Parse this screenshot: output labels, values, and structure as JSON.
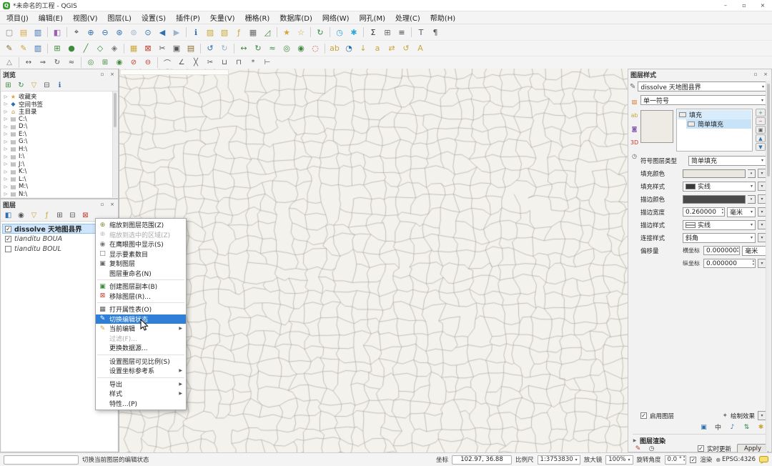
{
  "window": {
    "title": "*未命名的工程 - QGIS",
    "controls": {
      "minimize": "–",
      "maximize": "▫",
      "close": "×"
    }
  },
  "menu": {
    "items": [
      {
        "n": "menu-project",
        "label": "项目(J)"
      },
      {
        "n": "menu-edit",
        "label": "编辑(E)"
      },
      {
        "n": "menu-view",
        "label": "视图(V)"
      },
      {
        "n": "menu-layer",
        "label": "图层(L)"
      },
      {
        "n": "menu-settings",
        "label": "设置(S)"
      },
      {
        "n": "menu-plugins",
        "label": "插件(P)"
      },
      {
        "n": "menu-vector",
        "label": "矢量(V)"
      },
      {
        "n": "menu-raster",
        "label": "栅格(R)"
      },
      {
        "n": "menu-database",
        "label": "数据库(D)"
      },
      {
        "n": "menu-web",
        "label": "网络(W)"
      },
      {
        "n": "menu-mesh",
        "label": "网孔(M)"
      },
      {
        "n": "menu-processing",
        "label": "处理(C)"
      },
      {
        "n": "menu-help",
        "label": "帮助(H)"
      }
    ]
  },
  "toolbars": {
    "row1": [
      {
        "n": "new-project-icon",
        "g": "▢",
        "c": "#8a8a8a"
      },
      {
        "n": "open-project-icon",
        "g": "▤",
        "c": "#d9a33c"
      },
      {
        "n": "save-project-icon",
        "g": "▥",
        "c": "#3a6db4"
      },
      {
        "sep": 1
      },
      {
        "n": "style-manager-icon",
        "g": "◧",
        "c": "#9a5fb0"
      },
      {
        "sep": 1
      },
      {
        "n": "pan-map-icon",
        "g": "⌖",
        "c": "#333333"
      },
      {
        "n": "zoom-in-icon",
        "g": "⊕",
        "c": "#2e6fb0"
      },
      {
        "n": "zoom-out-icon",
        "g": "⊖",
        "c": "#2e6fb0"
      },
      {
        "n": "zoom-full-icon",
        "g": "⊛",
        "c": "#2e6fb0"
      },
      {
        "n": "zoom-to-selection-icon",
        "g": "⊚",
        "c": "#9ab4cc"
      },
      {
        "n": "zoom-to-layer-icon",
        "g": "⊙",
        "c": "#2e6fb0"
      },
      {
        "n": "zoom-last-icon",
        "g": "◀",
        "c": "#2e6fb0"
      },
      {
        "n": "zoom-next-icon",
        "g": "▶",
        "c": "#9ab4cc"
      },
      {
        "sep": 1
      },
      {
        "n": "identify-icon",
        "g": "ℹ",
        "c": "#2e6fb0"
      },
      {
        "n": "select-features-icon",
        "g": "▨",
        "c": "#c9a83a"
      },
      {
        "n": "deselect-icon",
        "g": "▧",
        "c": "#c9a83a"
      },
      {
        "n": "select-expression-icon",
        "g": "ƒ",
        "c": "#c9a83a"
      },
      {
        "n": "attribute-table-icon",
        "g": "▦",
        "c": "#666666"
      },
      {
        "n": "measure-icon",
        "g": "◿",
        "c": "#4a8a3c"
      },
      {
        "sep": 1
      },
      {
        "n": "new-bookmark-icon",
        "g": "★",
        "c": "#d9a33c"
      },
      {
        "n": "show-bookmarks-icon",
        "g": "☆",
        "c": "#d9a33c"
      },
      {
        "sep": 1
      },
      {
        "n": "refresh-map-icon",
        "g": "↻",
        "c": "#2e8a4a"
      },
      {
        "sep": 1
      },
      {
        "n": "temporal-control-icon",
        "g": "◷",
        "c": "#2ea8d8"
      },
      {
        "n": "freeze-canvas-icon",
        "g": "✱",
        "c": "#2ea8d8"
      },
      {
        "sep": 1
      },
      {
        "n": "statistics-icon",
        "g": "Σ",
        "c": "#333333"
      },
      {
        "n": "processing-toolbox-icon",
        "g": "⊞",
        "c": "#666666"
      },
      {
        "n": "toolbox-menu-icon",
        "g": "≡",
        "c": "#333333"
      },
      {
        "sep": 1
      },
      {
        "n": "annotation-text-icon",
        "g": "T",
        "c": "#555555"
      },
      {
        "n": "annotation-form-icon",
        "g": "¶",
        "c": "#555555"
      }
    ],
    "row2": [
      {
        "n": "current-edits-icon",
        "g": "✎",
        "c": "#8a6d2a"
      },
      {
        "n": "toggle-editing-icon",
        "g": "✎",
        "c": "#caa53a"
      },
      {
        "n": "save-edits-icon",
        "g": "▥",
        "c": "#3a6db4"
      },
      {
        "sep": 1
      },
      {
        "n": "add-record-icon",
        "g": "⊞",
        "c": "#3f8a3f"
      },
      {
        "n": "add-point-icon",
        "g": "●",
        "c": "#3f8a3f"
      },
      {
        "n": "add-line-icon",
        "g": "╱",
        "c": "#3f8a3f"
      },
      {
        "n": "add-polygon-icon",
        "g": "◇",
        "c": "#3f8a3f"
      },
      {
        "n": "vertex-tool-icon",
        "g": "◈",
        "c": "#777777"
      },
      {
        "sep": 1
      },
      {
        "n": "modify-attributes-icon",
        "g": "▦",
        "c": "#c9a83a"
      },
      {
        "n": "delete-selected-icon",
        "g": "⊠",
        "c": "#c0392b"
      },
      {
        "n": "cut-features-icon",
        "g": "✂",
        "c": "#555555"
      },
      {
        "n": "copy-features-icon",
        "g": "▣",
        "c": "#555555"
      },
      {
        "n": "paste-features-icon",
        "g": "▤",
        "c": "#8a6d2a"
      },
      {
        "sep": 1
      },
      {
        "n": "undo-icon",
        "g": "↺",
        "c": "#2e6fb0"
      },
      {
        "n": "redo-icon",
        "g": "↻",
        "c": "#9ab4cc"
      },
      {
        "sep": 1
      },
      {
        "n": "move-feature-icon",
        "g": "↔",
        "c": "#3f8a3f"
      },
      {
        "n": "rotate-feature-icon",
        "g": "↻",
        "c": "#3f8a3f"
      },
      {
        "n": "simplify-feature-icon",
        "g": "≈",
        "c": "#3f8a3f"
      },
      {
        "n": "add-ring-icon",
        "g": "◎",
        "c": "#3f8a3f"
      },
      {
        "n": "fill-ring-icon",
        "g": "◉",
        "c": "#3f8a3f"
      },
      {
        "n": "delete-ring-icon",
        "g": "◌",
        "c": "#c0392b"
      },
      {
        "sep": 1
      },
      {
        "n": "layer-labeling-icon",
        "g": "ab",
        "c": "#caa53a"
      },
      {
        "n": "layer-diagram-icon",
        "g": "◔",
        "c": "#2e6fb0"
      },
      {
        "n": "pin-labels-icon",
        "g": "↓",
        "c": "#caa53a"
      },
      {
        "n": "highlight-labels-icon",
        "g": "a",
        "c": "#caa53a"
      },
      {
        "n": "move-label-icon",
        "g": "⇄",
        "c": "#caa53a"
      },
      {
        "n": "rotate-label-icon",
        "g": "↺",
        "c": "#caa53a"
      },
      {
        "n": "change-label-icon",
        "g": "A",
        "c": "#caa53a"
      }
    ],
    "row3": [
      {
        "n": "enable-advanced-digitizing-icon",
        "g": "△",
        "c": "#777777"
      },
      {
        "sep": 1
      },
      {
        "n": "move-features-icon",
        "g": "↔",
        "c": "#555555"
      },
      {
        "n": "copy-move-features-icon",
        "g": "⇒",
        "c": "#555555"
      },
      {
        "n": "rotate-features-icon",
        "g": "↻",
        "c": "#555555"
      },
      {
        "n": "simplify-features-icon",
        "g": "≈",
        "c": "#555555"
      },
      {
        "sep": 1
      },
      {
        "n": "add-ring2-icon",
        "g": "◎",
        "c": "#3f8a3f"
      },
      {
        "n": "add-part-icon",
        "g": "⊞",
        "c": "#3f8a3f"
      },
      {
        "n": "fill-ring2-icon",
        "g": "◉",
        "c": "#3f8a3f"
      },
      {
        "n": "delete-ring2-icon",
        "g": "⊘",
        "c": "#c0392b"
      },
      {
        "n": "delete-part-icon",
        "g": "⊖",
        "c": "#c0392b"
      },
      {
        "sep": 1
      },
      {
        "n": "offset-curve-icon",
        "g": "⌒",
        "c": "#555555"
      },
      {
        "n": "reshape-features-icon",
        "g": "∠",
        "c": "#555555"
      },
      {
        "n": "split-features-icon",
        "g": "╳",
        "c": "#555555"
      },
      {
        "n": "split-parts-icon",
        "g": "✂",
        "c": "#555555"
      },
      {
        "n": "merge-features-icon",
        "g": "⊔",
        "c": "#555555"
      },
      {
        "n": "merge-attributes-icon",
        "g": "⊓",
        "c": "#555555"
      },
      {
        "n": "rotate-point-symbols-icon",
        "g": "*",
        "c": "#555555"
      },
      {
        "n": "trim-extend-icon",
        "g": "⊢",
        "c": "#555555"
      }
    ]
  },
  "browser": {
    "title": "浏览",
    "toolbar": [
      {
        "n": "browser-add-layer-icon",
        "g": "⊞",
        "c": "#3f8a3f"
      },
      {
        "n": "browser-refresh-icon",
        "g": "↻",
        "c": "#2e8a4a"
      },
      {
        "n": "browser-filter-icon",
        "g": "▽",
        "c": "#c9a83a"
      },
      {
        "n": "browser-collapse-icon",
        "g": "⊟",
        "c": "#555555"
      },
      {
        "n": "browser-properties-icon",
        "g": "ℹ",
        "c": "#2e6fb0"
      }
    ],
    "tree": [
      {
        "n": "browser-item-favorites",
        "arrow": "▷",
        "g": "★",
        "icc": "#d9a33c",
        "label": "收藏夹"
      },
      {
        "n": "browser-item-spatial-bookmarks",
        "arrow": "▷",
        "g": "◆",
        "icc": "#2e6fb0",
        "label": "空间书签"
      },
      {
        "n": "browser-item-home",
        "arrow": "▷",
        "g": "⌂",
        "icc": "#c08a2e",
        "label": "主目录"
      },
      {
        "n": "browser-item-drive-c",
        "arrow": "▷",
        "g": "▤",
        "icc": "#8a8a8a",
        "label": "C:\\"
      },
      {
        "n": "browser-item-drive-d",
        "arrow": "▷",
        "g": "▤",
        "icc": "#8a8a8a",
        "label": "D:\\"
      },
      {
        "n": "browser-item-drive-e",
        "arrow": "▷",
        "g": "▤",
        "icc": "#8a8a8a",
        "label": "E:\\"
      },
      {
        "n": "browser-item-drive-g",
        "arrow": "▷",
        "g": "▤",
        "icc": "#8a8a8a",
        "label": "G:\\"
      },
      {
        "n": "browser-item-drive-h",
        "arrow": "▷",
        "g": "▤",
        "icc": "#8a8a8a",
        "label": "H:\\"
      },
      {
        "n": "browser-item-drive-i",
        "arrow": "▷",
        "g": "▤",
        "icc": "#8a8a8a",
        "label": "I:\\"
      },
      {
        "n": "browser-item-drive-j",
        "arrow": "▷",
        "g": "▤",
        "icc": "#8a8a8a",
        "label": "J:\\"
      },
      {
        "n": "browser-item-drive-k",
        "arrow": "▷",
        "g": "▤",
        "icc": "#8a8a8a",
        "label": "K:\\"
      },
      {
        "n": "browser-item-drive-l",
        "arrow": "▷",
        "g": "▤",
        "icc": "#8a8a8a",
        "label": "L:\\"
      },
      {
        "n": "browser-item-drive-m",
        "arrow": "▷",
        "g": "▤",
        "icc": "#8a8a8a",
        "label": "M:\\"
      },
      {
        "n": "browser-item-drive-n",
        "arrow": "▷",
        "g": "▤",
        "icc": "#8a8a8a",
        "label": "N:\\"
      }
    ]
  },
  "layers": {
    "title": "图层",
    "toolbar": [
      {
        "n": "layers-style-panel-icon",
        "g": "◧",
        "c": "#2e6fb0"
      },
      {
        "n": "layers-map-themes-icon",
        "g": "◉",
        "c": "#555555"
      },
      {
        "n": "layers-filter-legend-icon",
        "g": "▽",
        "c": "#c9a83a"
      },
      {
        "n": "layers-filter-expression-icon",
        "g": "ƒ",
        "c": "#c9a83a"
      },
      {
        "n": "layers-expand-all-icon",
        "g": "⊞",
        "c": "#555555"
      },
      {
        "n": "layers-collapse-all-icon",
        "g": "⊟",
        "c": "#555555"
      },
      {
        "n": "layers-remove-icon",
        "g": "⊠",
        "c": "#c0392b"
      }
    ],
    "items": [
      {
        "n": "layer-item-dissolve",
        "label": "dissolve 天地图县界",
        "checked": 1,
        "selected": 1
      },
      {
        "n": "layer-item-tianditu-boua",
        "label": "tianditu BOUA",
        "checked": 1,
        "italic": 1
      },
      {
        "n": "layer-item-tianditu-boul",
        "label": "tianditu BOUL",
        "italic": 1
      }
    ]
  },
  "context_menu": {
    "items": [
      {
        "n": "context-zoom-to-layer",
        "g": "⊕",
        "icc": "#8a8a3a",
        "label": "缩放到图层范围(Z)"
      },
      {
        "n": "context-zoom-to-selection",
        "g": "⊕",
        "icc": "#bbbbbb",
        "label": "缩放到选中的区域(Z)",
        "disabled": 1
      },
      {
        "n": "context-show-in-overview",
        "g": "◉",
        "icc": "#777777",
        "label": "在鹰眼图中显示(S)"
      },
      {
        "n": "context-show-feature-count",
        "g": "□",
        "icc": "#666666",
        "label": "显示要素数目"
      },
      {
        "n": "context-copy-layer",
        "g": "▣",
        "icc": "#666666",
        "label": "复制图层"
      },
      {
        "n": "context-rename-layer",
        "label": "图层重命名(N)"
      },
      {
        "sep": 1
      },
      {
        "n": "context-duplicate-layer",
        "g": "▣",
        "icc": "#3f8a3f",
        "label": "创建图层副本(B)"
      },
      {
        "n": "context-remove-layer",
        "g": "⊠",
        "icc": "#c0392b",
        "label": "移除图层(R)..."
      },
      {
        "sep": 1
      },
      {
        "n": "context-open-attribute-table",
        "g": "▦",
        "icc": "#555555",
        "label": "打开属性表(O)"
      },
      {
        "n": "context-toggle-editing",
        "g": "✎",
        "icc": "#ffffff",
        "label": "切换编辑状态",
        "selected": 1
      },
      {
        "n": "context-current-edits",
        "g": "✎",
        "icc": "#caa53a",
        "label": "当前编辑",
        "arrow": "▶"
      },
      {
        "n": "context-filter",
        "label": "过滤(F)...",
        "disabled": 1
      },
      {
        "n": "context-change-data-source",
        "label": "更换数据源..."
      },
      {
        "sep": 1
      },
      {
        "n": "context-set-scale-visibility",
        "label": "设置图层可见比例(S)"
      },
      {
        "n": "context-set-crs",
        "label": "设置坐标参考系",
        "arrow": "▶"
      },
      {
        "sep": 1
      },
      {
        "n": "context-export",
        "label": "导出",
        "arrow": "▶"
      },
      {
        "n": "context-styles",
        "label": "样式",
        "arrow": "▶"
      },
      {
        "n": "context-properties",
        "label": "特性...(P)"
      }
    ]
  },
  "styling": {
    "title": "图层样式",
    "layer_combo": "dissolve 天地图县界",
    "left_tabs": [
      {
        "n": "styling-tab-symbology",
        "g": "▨",
        "c": "#d97b2e"
      },
      {
        "n": "styling-tab-labels",
        "g": "ab",
        "c": "#caa53a"
      },
      {
        "n": "styling-tab-masks",
        "g": "◙",
        "c": "#8a5fb0"
      },
      {
        "n": "styling-tab-3d",
        "g": "3D",
        "c": "#c0392b"
      },
      {
        "n": "styling-tab-history",
        "g": "◷",
        "c": "#555555"
      }
    ],
    "symbol_combo": "单一符号",
    "tree": {
      "fill": "填充",
      "simple_fill": "简单填充"
    },
    "tree_buttons": [
      {
        "n": "symbol-add-button",
        "g": "+",
        "c": "#2e8a4a"
      },
      {
        "n": "symbol-remove-button",
        "g": "−",
        "c": "#c0392b"
      },
      {
        "n": "symbol-duplicate-button",
        "g": "▣",
        "c": "#555555"
      },
      {
        "n": "symbol-up-button",
        "g": "▲",
        "c": "#2e6fb0"
      },
      {
        "n": "symbol-down-button",
        "g": "▼",
        "c": "#2e6fb0"
      }
    ],
    "section_label": "符号图层类型",
    "layer_type_combo": "简单填充",
    "rows": {
      "fill_color_label": "填充颜色",
      "fill_style_label": "填充样式",
      "fill_style_value": "实线",
      "stroke_color_label": "描边颜色",
      "stroke_width_label": "描边宽度",
      "stroke_width_value": "0.260000",
      "unit_mm": "毫米",
      "stroke_style_label": "描边样式",
      "stroke_style_value": "实线",
      "join_style_label": "连接样式",
      "join_style_value": "斜角",
      "offset_label": "偏移量",
      "offset_x_label": "横坐标",
      "offset_y_label": "纵坐标",
      "offset_x_value": "0.000000",
      "offset_y_value": "0.000000"
    },
    "colors": {
      "fill": "#e9e7df",
      "stroke": "#4a4a4a",
      "preview": "#edebe3"
    },
    "enable_layer": "启用图层",
    "draw_effects": "绘制效果",
    "bottom_icons": [
      {
        "n": "style-library-icon",
        "g": "▣",
        "c": "#2e6fb0"
      },
      {
        "n": "style-center-icon",
        "g": "中",
        "c": "#333333"
      },
      {
        "n": "style-marker-icon",
        "g": "♪",
        "c": "#2e6fb0"
      },
      {
        "n": "style-updown-icon",
        "g": "⇅",
        "c": "#2e8a4a"
      },
      {
        "n": "style-options-icon",
        "g": "✱",
        "c": "#caa53a"
      }
    ],
    "layer_rendering": "图层渲染",
    "live_update": "实时更新",
    "apply": "Apply"
  },
  "map": {
    "background": "#f4f2ec",
    "boundary_color": "rgba(150,145,135,0.85)"
  },
  "status": {
    "message": "切换当前图层的编辑状态",
    "coord_label": "坐标",
    "coord_value": "102.97, 36.88",
    "scale_label": "比例尺",
    "scale_value": "1:3753830",
    "magnifier_label": "放大镜",
    "magnifier_value": "100%",
    "rotation_label": "旋转角度",
    "rotation_value": "0.0 °",
    "render_label": "渲染",
    "crs": "EPSG:4326"
  }
}
